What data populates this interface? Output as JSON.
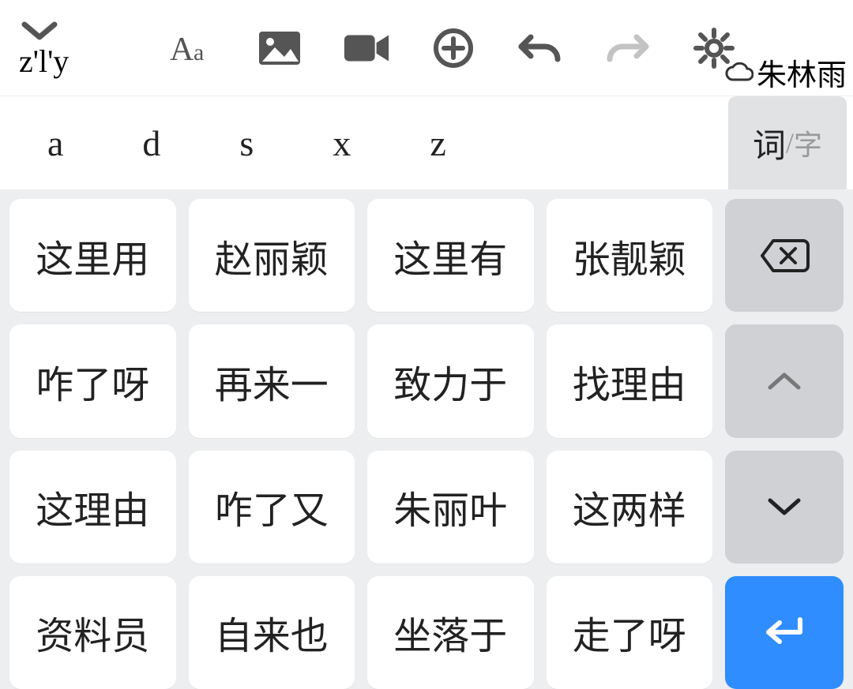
{
  "toolbar": {
    "pinyin": "z'l'y",
    "user_name": "朱林雨"
  },
  "letter_row": {
    "letters": [
      "a",
      "d",
      "s",
      "x",
      "z"
    ],
    "mode_main": "词",
    "mode_sep": "/",
    "mode_sub": "字"
  },
  "candidates": [
    "这里用",
    "赵丽颖",
    "这里有",
    "张靓颖",
    "咋了呀",
    "再来一",
    "致力于",
    "找理由",
    "这理由",
    "咋了又",
    "朱丽叶",
    "这两样",
    "资料员",
    "自来也",
    "坐落于",
    "走了呀"
  ]
}
